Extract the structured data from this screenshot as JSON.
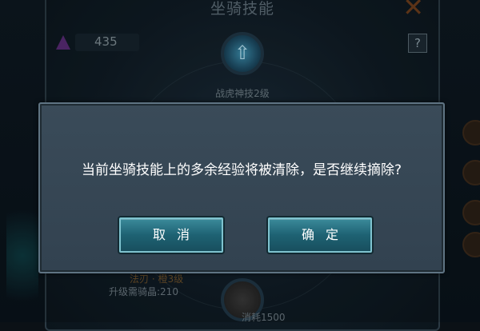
{
  "background": {
    "title": "坐骑技能",
    "gem_count": "435",
    "help_label": "?",
    "top_skill_name": "战虎神技2级",
    "bottom_skill_name": "法刃 · 橙3级",
    "bottom_skill_cost": "升级需骑晶:210",
    "bottom_consume": "消耗1500"
  },
  "dialog": {
    "message": "当前坐骑技能上的多余经验将被清除，是否继续摘除?",
    "cancel_label": "取消",
    "confirm_label": "确定"
  },
  "colors": {
    "dialog_bg": "#354654",
    "button_teal": "#1e6273",
    "message_text": "#ffffff"
  },
  "icons": [
    "gem-icon",
    "help-icon",
    "close-icon",
    "skill-arrow-icon"
  ]
}
